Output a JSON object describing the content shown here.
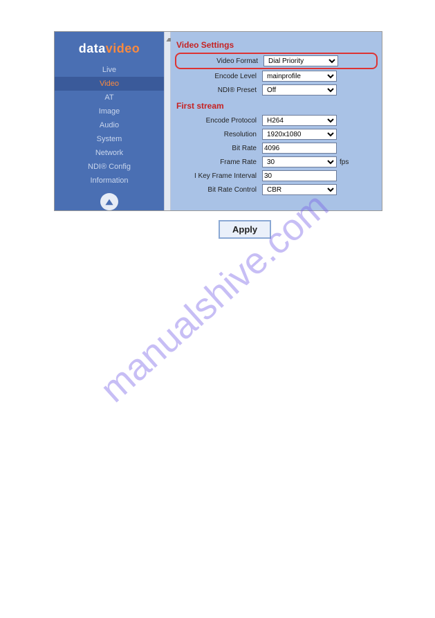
{
  "logo": {
    "part1": "data",
    "part2": "video"
  },
  "sidebar": {
    "items": [
      {
        "label": "Live"
      },
      {
        "label": "Video"
      },
      {
        "label": "AT"
      },
      {
        "label": "Image"
      },
      {
        "label": "Audio"
      },
      {
        "label": "System"
      },
      {
        "label": "Network"
      },
      {
        "label": "NDI® Config"
      },
      {
        "label": "Information"
      }
    ]
  },
  "panel": {
    "section1": "Video Settings",
    "video_format_label": "Video Format",
    "video_format_value": "Dial Priority",
    "encode_level_label": "Encode Level",
    "encode_level_value": "mainprofile",
    "ndi_preset_label": "NDI® Preset",
    "ndi_preset_value": "Off",
    "section2": "First stream",
    "encode_protocol_label": "Encode Protocol",
    "encode_protocol_value": "H264",
    "resolution_label": "Resolution",
    "resolution_value": "1920x1080",
    "bitrate_label": "Bit Rate",
    "bitrate_value": "4096",
    "framerate_label": "Frame Rate",
    "framerate_value": "30",
    "framerate_suffix": "fps",
    "keyframe_label": "I Key Frame Interval",
    "keyframe_value": "30",
    "brcontrol_label": "Bit Rate Control",
    "brcontrol_value": "CBR"
  },
  "apply_label": "Apply",
  "watermark": "manualshive.com"
}
